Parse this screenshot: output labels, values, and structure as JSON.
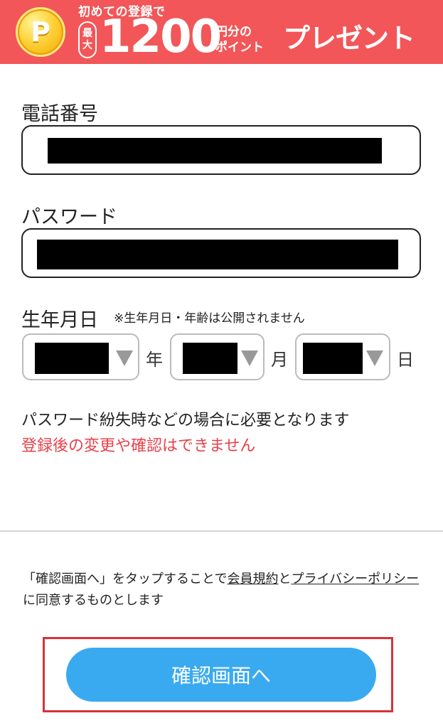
{
  "banner": {
    "coin_letter": "P",
    "top_text": "初めての登録で",
    "max_line1": "最",
    "max_line2": "大",
    "amount": "1200",
    "unit_line1": "円分の",
    "unit_line2": "ポイント",
    "present": "プレゼント",
    "background_color": "#f25658"
  },
  "form": {
    "phone_label": "電話番号",
    "password_label": "パスワード",
    "birthday_label": "生年月日",
    "birthday_note": "※生年月日・年齢は公開されません",
    "year_unit": "年",
    "month_unit": "月",
    "day_unit": "日",
    "note_black": "パスワード紛失時などの場合に必要となります",
    "note_red": "登録後の変更や確認はできません",
    "accent_red": "#e8414a"
  },
  "terms": {
    "prefix": "「確認画面へ」をタップすることで",
    "link1": "会員規約",
    "middle": "と",
    "link2": "プライバシーポリシー",
    "suffix": "に同意するものとします"
  },
  "confirm_button": {
    "label": "確認画面へ",
    "color": "#3aaaf0"
  }
}
